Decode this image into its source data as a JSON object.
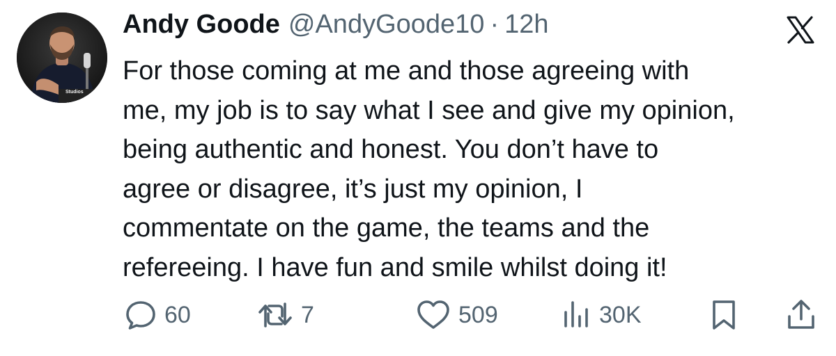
{
  "tweet": {
    "author_name": "Andy Goode",
    "handle": "@AndyGoode10",
    "separator": "·",
    "time_ago": "12h",
    "text_lines": [
      "For those coming at me and those agreeing with",
      "me, my job is to say what I see and give my opinion,",
      "being authentic and honest. You don’t have to",
      "agree or disagree, it’s just my opinion, I",
      "commentate on the game, the teams and the",
      "refereeing. I have fun and smile whilst doing it!"
    ]
  },
  "brand": {
    "icon": "x-logo-icon"
  },
  "avatar": {
    "caption": "Studios"
  },
  "actions": {
    "replies": "60",
    "reposts": "7",
    "likes": "509",
    "views": "30K",
    "icons": [
      "reply-icon",
      "repost-icon",
      "like-icon",
      "views-icon",
      "bookmark-icon",
      "share-icon"
    ]
  },
  "colors": {
    "text_primary": "#0f1419",
    "text_secondary": "#536471",
    "background": "#ffffff"
  }
}
